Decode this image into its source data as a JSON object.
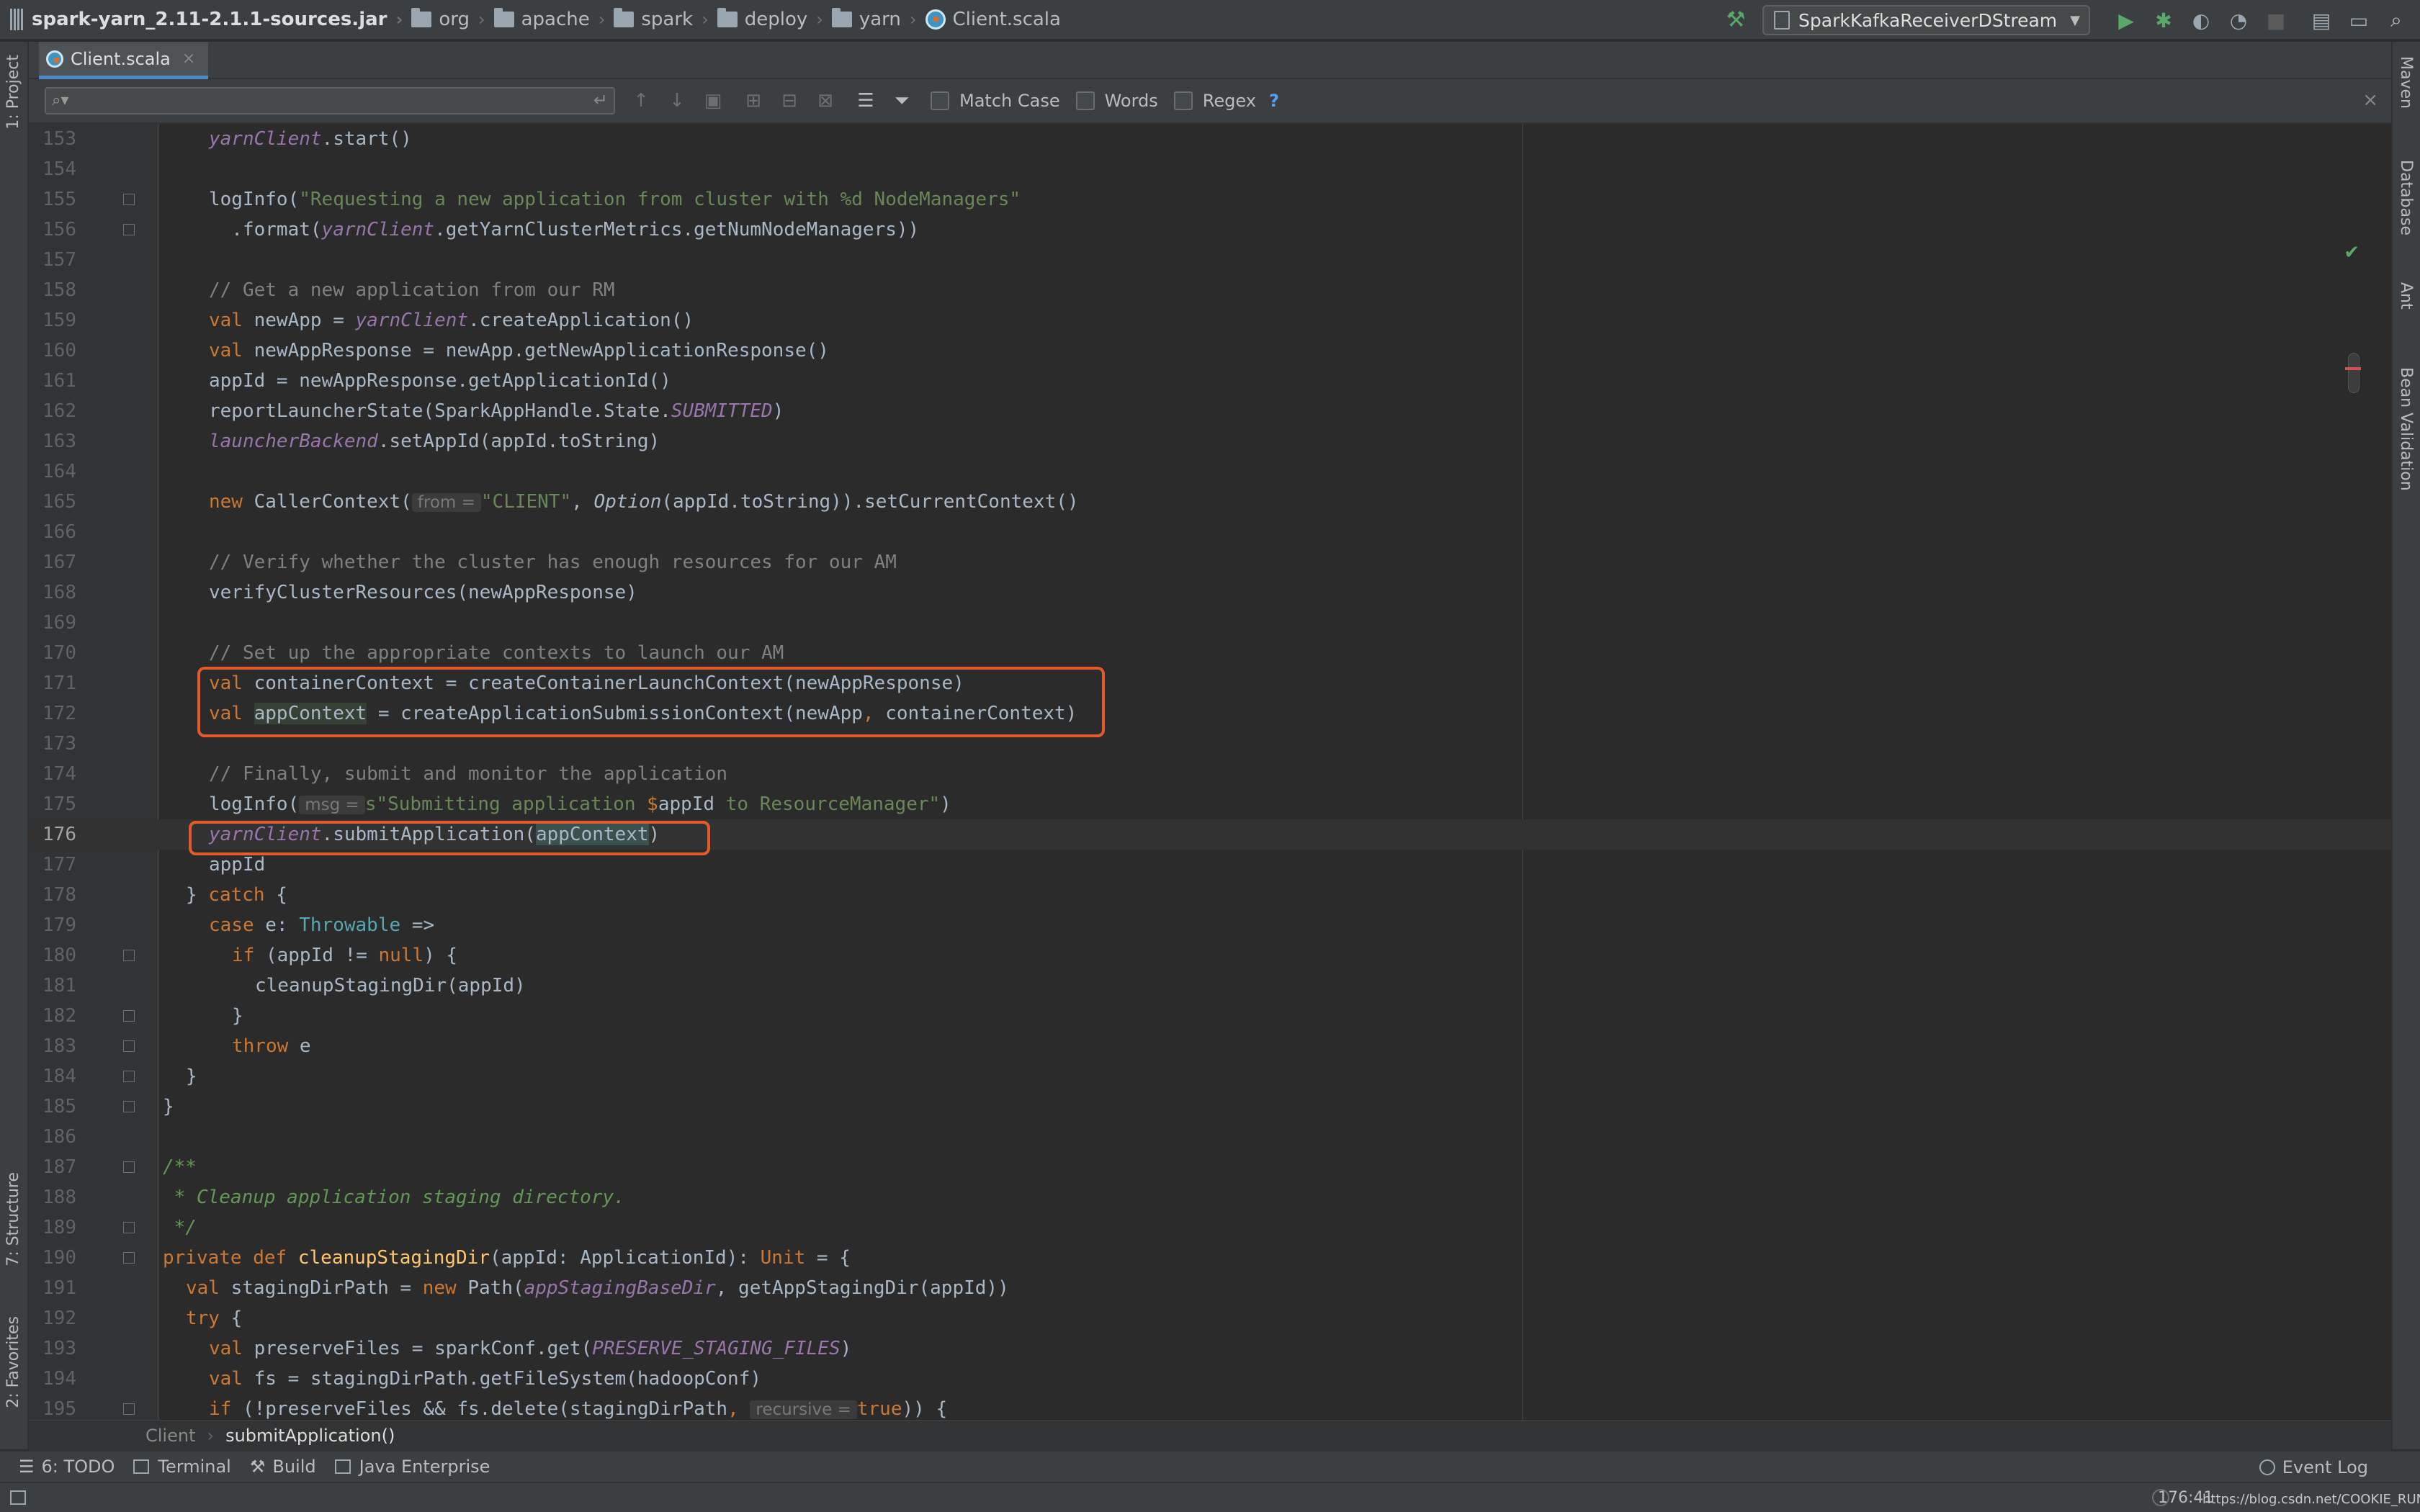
{
  "navbar": {
    "crumbs": [
      "spark-yarn_2.11-2.1.1-sources.jar",
      "org",
      "apache",
      "spark",
      "deploy",
      "yarn",
      "Client.scala"
    ],
    "run_config": "SparkKafkaReceiverDStream"
  },
  "tabs": [
    {
      "label": "Client.scala"
    }
  ],
  "find": {
    "placeholder": "",
    "match_case": "Match Case",
    "words": "Words",
    "regex": "Regex",
    "help": "?"
  },
  "left_tools": [
    "1: Project",
    "7: Structure",
    "2: Favorites"
  ],
  "right_tools": [
    "Maven",
    "Database",
    "Ant",
    "Bean Validation"
  ],
  "editor": {
    "current_line": 176,
    "lines": [
      {
        "n": "153"
      },
      {
        "n": "154"
      },
      {
        "n": "155"
      },
      {
        "n": "156"
      },
      {
        "n": "157"
      },
      {
        "n": "158"
      },
      {
        "n": "159"
      },
      {
        "n": "160"
      },
      {
        "n": "161"
      },
      {
        "n": "162"
      },
      {
        "n": "163"
      },
      {
        "n": "164"
      },
      {
        "n": "165"
      },
      {
        "n": "166"
      },
      {
        "n": "167"
      },
      {
        "n": "168"
      },
      {
        "n": "169"
      },
      {
        "n": "170"
      },
      {
        "n": "171"
      },
      {
        "n": "172"
      },
      {
        "n": "173"
      },
      {
        "n": "174"
      },
      {
        "n": "175"
      },
      {
        "n": "176"
      },
      {
        "n": "177"
      },
      {
        "n": "178"
      },
      {
        "n": "179"
      },
      {
        "n": "180"
      },
      {
        "n": "181"
      },
      {
        "n": "182"
      },
      {
        "n": "183"
      },
      {
        "n": "184"
      },
      {
        "n": "185"
      },
      {
        "n": "186"
      },
      {
        "n": "187"
      },
      {
        "n": "188"
      },
      {
        "n": "189"
      },
      {
        "n": "190"
      },
      {
        "n": "191"
      },
      {
        "n": "192"
      },
      {
        "n": "193"
      },
      {
        "n": "194"
      },
      {
        "n": "195"
      }
    ],
    "code": {
      "l153": "yarnClient",
      "l153b": ".start()",
      "l155a": "logInfo(",
      "l155b": "\"Requesting a new application from cluster with %d NodeManagers\"",
      "l156a": "  .format(",
      "l156b": "yarnClient",
      "l156c": ".getYarnClusterMetrics.getNumNodeManagers))",
      "l158": "// Get a new application from our RM",
      "l159a": "val",
      "l159b": " newApp = ",
      "l159c": "yarnClient",
      "l159d": ".createApplication()",
      "l160a": "val",
      "l160b": " newAppResponse = newApp.getNewApplicationResponse()",
      "l161": "appId = newAppResponse.getApplicationId()",
      "l162a": "reportLauncherState(SparkAppHandle.State.",
      "l162b": "SUBMITTED",
      "l162c": ")",
      "l163a": "launcherBackend",
      "l163b": ".setAppId(appId.toString)",
      "l165a": "new",
      "l165b": " CallerContext(",
      "l165h": "from =",
      "l165c": "\"CLIENT\"",
      "l165d": ", ",
      "l165e": "Option",
      "l165f": "(appId.toString)).setCurrentContext()",
      "l167": "// Verify whether the cluster has enough resources for our AM",
      "l168": "verifyClusterResources(newAppResponse)",
      "l170": "// Set up the appropriate contexts to launch our AM",
      "l171a": "val",
      "l171b": " containerContext = createContainerLaunchContext(newAppResponse)",
      "l172a": "val",
      "l172b": " ",
      "l172c": "appContext",
      "l172d": " = createApplicationSubmissionContext(newApp",
      "l172e": ",",
      "l172f": " containerContext)",
      "l174": "// Finally, submit and monitor the application",
      "l175a": "logInfo(",
      "l175h": "msg =",
      "l175b": "s\"Submitting application ",
      "l175c": "$",
      "l175d": "appId",
      "l175e": " to ResourceManager\"",
      "l175f": ")",
      "l176a": "yarnClient",
      "l176b": ".submitApplication(",
      "l176c": "appContext",
      "l176d": ")",
      "l177": "appId",
      "l178a": "} ",
      "l178b": "catch",
      "l178c": " {",
      "l179a": "case",
      "l179b": " e: ",
      "l179c": "Throwable",
      "l179d": " =>",
      "l180a": "if",
      "l180b": " (appId != ",
      "l180c": "null",
      "l180d": ") {",
      "l181": "cleanupStagingDir(appId)",
      "l182": "}",
      "l183a": "throw",
      "l183b": " e",
      "l184": "}",
      "l185": "}",
      "l187": "/**",
      "l188": " * Cleanup application staging directory.",
      "l189": " */",
      "l190a": "private",
      "l190b": " ",
      "l190c": "def",
      "l190d": " ",
      "l190e": "cleanupStagingDir",
      "l190f": "(appId: ApplicationId): ",
      "l190g": "Unit",
      "l190i": " = {",
      "l191a": "val",
      "l191b": " stagingDirPath = ",
      "l191c": "new",
      "l191d": " Path(",
      "l191e": "appStagingBaseDir",
      "l191f": ", getAppStagingDir(appId))",
      "l192a": "try",
      "l192b": " {",
      "l193a": "val",
      "l193b": " preserveFiles = sparkConf.get(",
      "l193c": "PRESERVE_STAGING_FILES",
      "l193d": ")",
      "l194a": "val",
      "l194b": " fs = stagingDirPath.getFileSystem(hadoopConf)",
      "l195a": "if",
      "l195b": " (!preserveFiles && fs.delete(stagingDirPath",
      "l195c": ",",
      "l195h": "recursive =",
      "l195d": "true",
      "l195e": ")) {"
    }
  },
  "breadcrumb": {
    "class": "Client",
    "method": "submitApplication()"
  },
  "bottom_tools": [
    "6: TODO",
    "Terminal",
    "Build",
    "Java Enterprise"
  ],
  "event_log": "Event Log",
  "status": {
    "position": "176:41",
    "watermark": "https://blog.csdn.net/COOKIE_RUN"
  },
  "colors": {
    "keyword": "#cc7832",
    "string": "#6a8759",
    "comment": "#808080",
    "field": "#9876aa",
    "highlight_box": "#e55a2b",
    "run": "#59a869"
  }
}
